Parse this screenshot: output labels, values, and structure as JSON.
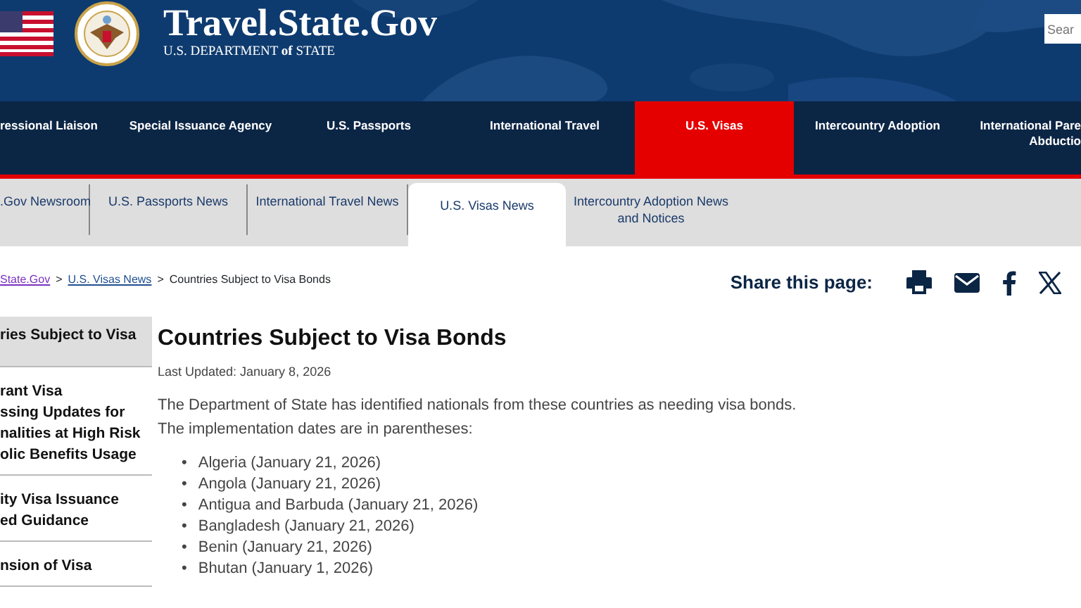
{
  "header": {
    "title": "Travel.State.Gov",
    "subtitle": "U.S. DEPARTMENT **of** STATE",
    "search": {
      "placeholder": "Sear"
    }
  },
  "main_nav": [
    {
      "lines": [
        "ressional Liaison"
      ],
      "selected": false
    },
    {
      "lines": [
        "Special Issuance Agency"
      ],
      "selected": false
    },
    {
      "lines": [
        "U.S. Passports"
      ],
      "selected": false
    },
    {
      "lines": [
        "International Travel"
      ],
      "selected": false
    },
    {
      "lines": [
        "U.S. Visas"
      ],
      "selected": true
    },
    {
      "lines": [
        "Intercountry Adoption"
      ],
      "selected": false
    },
    {
      "lines": [
        "International Pare",
        "Abductio"
      ],
      "selected": false
    }
  ],
  "sub_nav": [
    {
      "lines": [
        ".Gov Newsroom"
      ],
      "selected": false
    },
    {
      "lines": [
        "U.S. Passports News"
      ],
      "selected": false
    },
    {
      "lines": [
        "International Travel News"
      ],
      "selected": false
    },
    {
      "lines": [
        "U.S. Visas News"
      ],
      "selected": true
    },
    {
      "lines": [
        "Intercountry Adoption News",
        "and Notices"
      ],
      "selected": false
    }
  ],
  "breadcrumb": [
    {
      "kind": "visited",
      "text": "State.Gov"
    },
    {
      "kind": "sep",
      "text": ">"
    },
    {
      "kind": "link",
      "text": "U.S. Visas News"
    },
    {
      "kind": "sep",
      "text": ">"
    },
    {
      "kind": "current",
      "text": "Countries Subject to Visa Bonds"
    }
  ],
  "share": {
    "label": "Share this page:"
  },
  "sidebar": [
    {
      "lines": [
        "ries Subject to Visa"
      ],
      "selected": true
    },
    {
      "lines": [
        "rant Visa",
        "ssing Updates for",
        "nalities at High Risk",
        "olic Benefits Usage"
      ],
      "selected": false
    },
    {
      "lines": [
        "ity Visa Issuance",
        "ed Guidance"
      ],
      "selected": false
    },
    {
      "lines": [
        "nsion of Visa"
      ],
      "selected": false
    }
  ],
  "article": {
    "title": "Countries Subject to Visa Bonds",
    "updated": "Last Updated: January 8, 2026",
    "intro": "The Department of State has identified nationals from these countries as needing visa bonds.  The implementation dates are in parentheses:",
    "marker": "•",
    "items": [
      "Algeria (January 21, 2026)",
      "Angola (January 21, 2026)",
      "Antigua and Barbuda (January 21, 2026)",
      "Bangladesh (January 21, 2026)",
      "Benin (January 21, 2026)",
      "Bhutan (January 1, 2026)"
    ]
  }
}
